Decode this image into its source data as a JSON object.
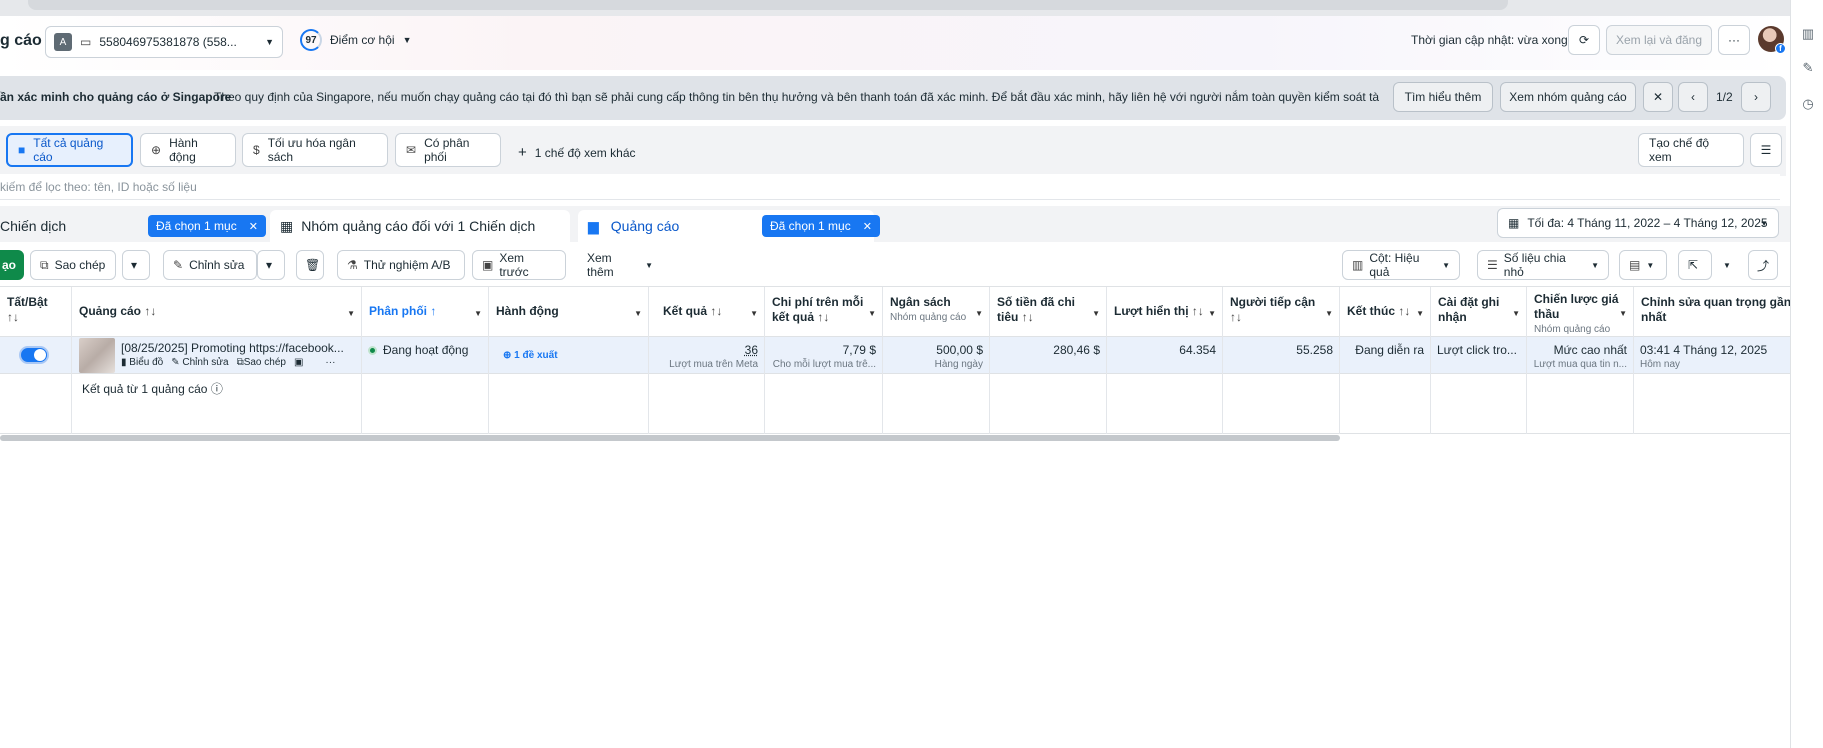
{
  "header": {
    "page_title": "g cáo",
    "account_badge": "A",
    "account_name": "558046975381878 (558...",
    "opportunity_score": "97",
    "opportunity_label": "Điểm cơ hội",
    "update_status": "Thời gian cập nhật: vừa xong",
    "review_publish_label": "Xem lại và đăng",
    "more_label": "···"
  },
  "banner": {
    "title": "ần xác minh cho quảng cáo ở Singapore",
    "message": "Theo quy định của Singapore, nếu muốn chạy quảng cáo tại đó thì bạn sẽ phải cung cấp thông tin bên thụ hưởng và bên thanh toán đã xác minh. Để bắt đầu xác minh, hãy liên hệ với người nắm toàn quyền kiểm soát tài khoản quả...",
    "learn_more_label": "Tìm hiểu thêm",
    "view_adsets_label": "Xem nhóm quảng cáo",
    "pager": "1/2"
  },
  "views": {
    "all_ads": "Tất cả quảng cáo",
    "actions": "Hành động",
    "budget_opt": "Tối ưu hóa ngân sách",
    "delivery": "Có phân phối",
    "more_views": "1 chế độ xem khác",
    "create_view": "Tạo chế độ xem"
  },
  "search": {
    "placeholder": "kiếm để lọc theo: tên, ID hoặc số liệu"
  },
  "tabs": {
    "campaigns": "Chiến dịch",
    "campaigns_chip": "Đã chọn 1 mục",
    "adsets": "Nhóm quảng cáo đối với 1 Chiến dịch",
    "ads": "Quảng cáo",
    "ads_chip": "Đã chọn 1 mục",
    "date_range": "Tối đa: 4 Tháng 11, 2022 – 4 Tháng 12, 2025"
  },
  "toolbar": {
    "create": "ạo",
    "duplicate": "Sao chép",
    "edit": "Chỉnh sửa",
    "ab_test": "Thử nghiệm A/B",
    "preview": "Xem trước",
    "more": "Xem thêm",
    "columns": "Cột: Hiệu quả",
    "breakdown": "Số liệu chia nhỏ"
  },
  "columns": {
    "toggle": "Tất/Bật",
    "toggle_sort": "↑↓",
    "ad": "Quảng cáo",
    "ad_sort": "↑↓",
    "delivery": "Phân phối",
    "delivery_sort": "↑",
    "actions": "Hành động",
    "results": "Kết quả",
    "results_sort": "↑↓",
    "cpr_line1": "Chi phí trên mỗi",
    "cpr_line2": "kết quả",
    "cpr_sort": "↑↓",
    "budget": "Ngân sách",
    "budget_sub": "Nhóm quảng cáo",
    "spent_line1": "Số tiền đã chi",
    "spent_line2": "tiêu",
    "spent_sort": "↑↓",
    "impressions": "Lượt hiển thị",
    "impressions_sort": "↑↓",
    "reach": "Người tiếp cận",
    "reach_sort": "↑↓",
    "end": "Kết thúc",
    "end_sort": "↑↓",
    "attribution_line1": "Cài đặt ghi",
    "attribution_line2": "nhận",
    "bid_line1": "Chiến lược giá",
    "bid_line2": "thầu",
    "bid_sub": "Nhóm quảng cáo",
    "edit_line1": "Chỉnh sửa quan trọng gần đ",
    "edit_line2": "nhất"
  },
  "row": {
    "ad_name": "[08/25/2025] Promoting https://facebook...",
    "act_chart": "Biểu đồ",
    "act_edit": "Chỉnh sửa",
    "act_duplicate": "Sao chép",
    "delivery": "Đang hoạt động",
    "suggestion": "1 đề xuất",
    "results": "36",
    "results_sub": "Lượt mua trên Meta",
    "cpr": "7,79 $",
    "cpr_sub": "Cho mỗi lượt mua trê...",
    "budget": "500,00 $",
    "budget_sub": "Hàng ngày",
    "spent": "280,46 $",
    "impressions": "64.354",
    "reach": "55.258",
    "end": "Đang diễn ra",
    "attribution": "Lượt click tro...",
    "bid": "Mức cao nhất",
    "bid_sub": "Lượt mua qua tin n...",
    "last_edit": "03:41 4 Tháng 12, 2025",
    "last_edit_sub": "Hôm nay"
  },
  "summary": {
    "label": "Kết quả từ 1 quảng cáo"
  }
}
